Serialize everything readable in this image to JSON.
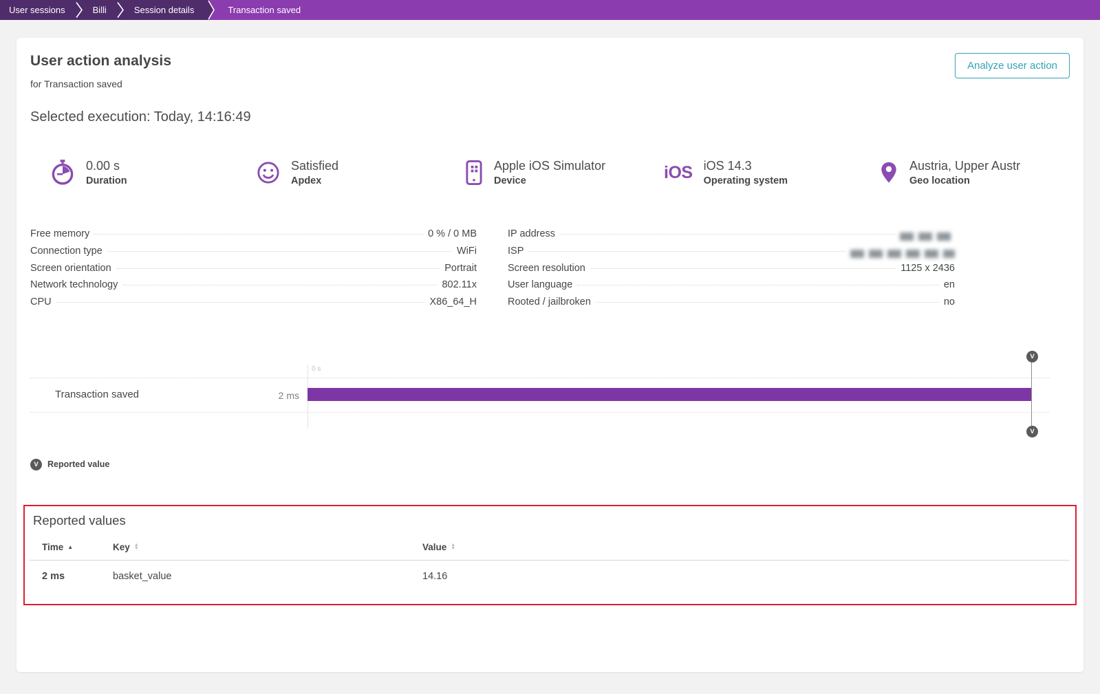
{
  "breadcrumb": {
    "items": [
      {
        "label": "User sessions"
      },
      {
        "label": "Billi"
      },
      {
        "label": "Session details"
      }
    ],
    "current": "Transaction saved"
  },
  "header": {
    "title": "User action analysis",
    "subtitle": "for Transaction saved",
    "selected_execution": "Selected execution: Today, 14:16:49",
    "analyze_button": "Analyze user action"
  },
  "stats": [
    {
      "icon": "stopwatch-icon",
      "value": "0.00 s",
      "label": "Duration"
    },
    {
      "icon": "smiley-icon",
      "value": "Satisfied",
      "label": "Apdex"
    },
    {
      "icon": "mobile-phone-icon",
      "value": "Apple iOS Simulator",
      "label": "Device"
    },
    {
      "icon": "ios-logo",
      "logo_text": "iOS",
      "value": "iOS 14.3",
      "label": "Operating system"
    },
    {
      "icon": "location-pin-icon",
      "value": "Austria, Upper Austr",
      "label": "Geo location"
    }
  ],
  "properties": {
    "left": [
      {
        "label": "Free memory",
        "value": "0 % / 0 MB"
      },
      {
        "label": "Connection type",
        "value": "WiFi"
      },
      {
        "label": "Screen orientation",
        "value": "Portrait"
      },
      {
        "label": "Network technology",
        "value": "802.11x"
      },
      {
        "label": "CPU",
        "value": "X86_64_H"
      }
    ],
    "right": [
      {
        "label": "IP address",
        "value": "",
        "redacted": true
      },
      {
        "label": "ISP",
        "value": "",
        "redacted": true
      },
      {
        "label": "Screen resolution",
        "value": "1125 x 2436"
      },
      {
        "label": "User language",
        "value": "en"
      },
      {
        "label": "Rooted / jailbroken",
        "value": "no"
      }
    ]
  },
  "timeline": {
    "axis_label": "0 s",
    "rows": [
      {
        "label": "Transaction saved",
        "duration": "2 ms"
      }
    ],
    "marker_letter": "V",
    "bar_color": "#7d36a5"
  },
  "legend": {
    "marker_letter": "V",
    "label": "Reported value"
  },
  "reported_values": {
    "title": "Reported values",
    "columns": [
      {
        "label": "Time",
        "sort": "asc"
      },
      {
        "label": "Key",
        "sort": "none"
      },
      {
        "label": "Value",
        "sort": "none"
      }
    ],
    "rows": [
      {
        "time": "2 ms",
        "key": "basket_value",
        "value": "14.16"
      }
    ]
  },
  "colors": {
    "breadcrumb_dark": "#4f2c6a",
    "breadcrumb_light": "#8b3cae",
    "accent_purple": "#7d36a5",
    "icon_purple": "#8a4cb0",
    "button_teal": "#35a2b5",
    "highlight_red": "#dc1e2e",
    "page_background": "#f2f2f2"
  }
}
